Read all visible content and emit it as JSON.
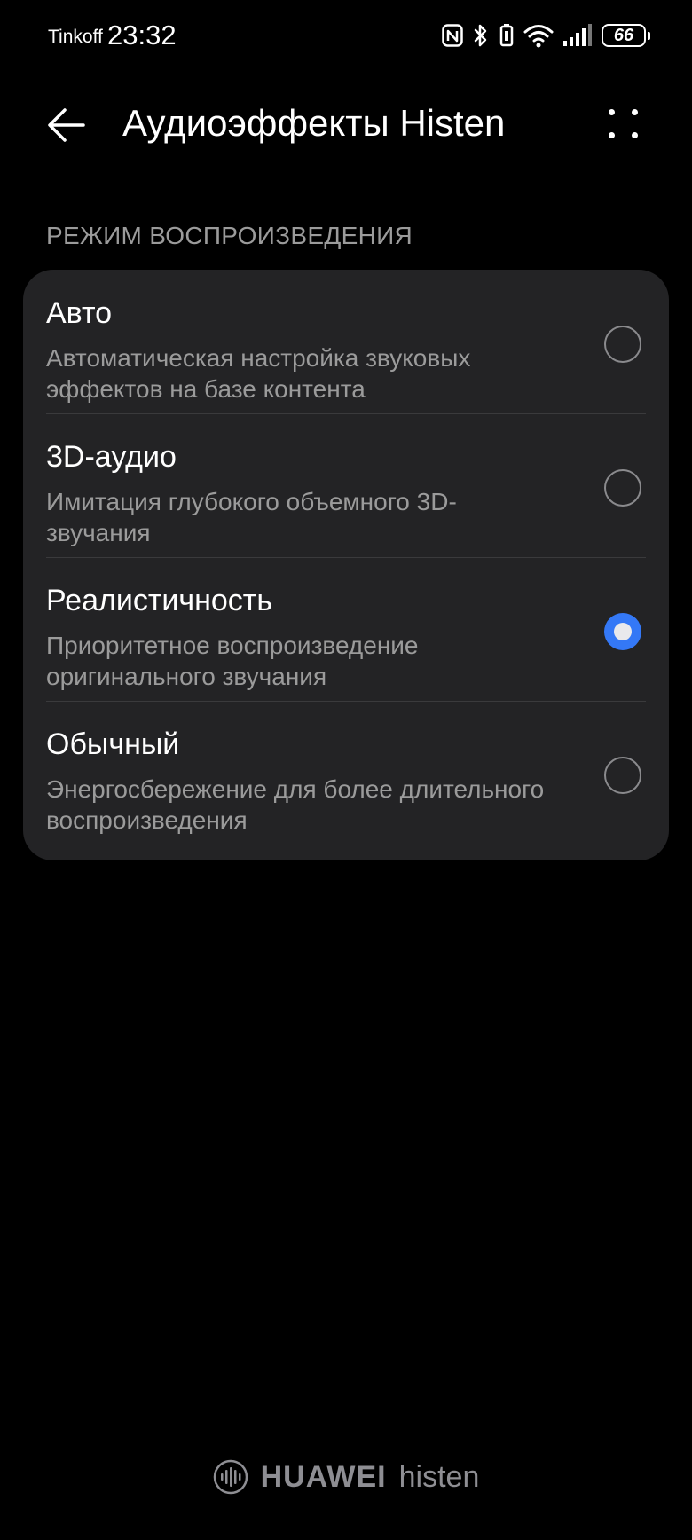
{
  "status_bar": {
    "carrier": "Tinkoff",
    "time": "23:32",
    "battery": "66",
    "icons": [
      "nfc-icon",
      "bluetooth-icon",
      "vibrate-icon",
      "wifi-icon",
      "signal-icon",
      "battery-icon"
    ]
  },
  "app_bar": {
    "title": "Аудиоэффекты Histen",
    "back_icon": "back-arrow-icon",
    "more_icon": "more-icon"
  },
  "section": {
    "header": "РЕЖИМ ВОСПРОИЗВЕДЕНИЯ",
    "options": [
      {
        "title": "Авто",
        "description": "Автоматическая настройка звуковых эффектов на базе контента",
        "selected": false
      },
      {
        "title": "3D-аудио",
        "description": "Имитация глубокого объемного 3D-звучания",
        "selected": false
      },
      {
        "title": "Реалистичность",
        "description": "Приоритетное воспроизведение оригинального звучания",
        "selected": true
      },
      {
        "title": "Обычный",
        "description": "Энергосбережение для более длительного воспроизведения",
        "selected": false
      }
    ]
  },
  "footer": {
    "brand": "HUAWEI",
    "product": "histen",
    "logo_icon": "histen-logo-icon"
  },
  "colors": {
    "background": "#000000",
    "card": "#232325",
    "accent": "#3478f6",
    "secondary_text": "#9b9b9b"
  }
}
